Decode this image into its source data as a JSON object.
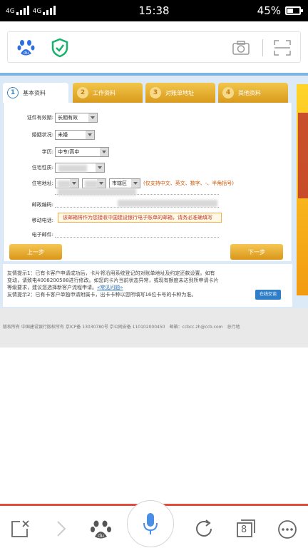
{
  "status_bar": {
    "network": "4G",
    "network2": "4G",
    "time": "15:38",
    "battery": "45%",
    "battery_level": 0.45
  },
  "browser": {
    "logo_icon": "baidu-paw-icon",
    "security_icon": "shield-check-icon",
    "camera_icon": "camera-icon",
    "scan_icon": "scan-icon"
  },
  "form": {
    "tabs": [
      {
        "num": "1",
        "label": "基本资料"
      },
      {
        "num": "2",
        "label": "工作资料"
      },
      {
        "num": "3",
        "label": "对账单地址"
      },
      {
        "num": "4",
        "label": "其他资料"
      }
    ],
    "fields": {
      "id_validity_label": "证件有效期:",
      "id_validity_value": "长期有效",
      "marital_label": "婚姻状况:",
      "marital_value": "未婚",
      "education_label": "学历:",
      "education_value": "中专/高中",
      "residence_type_label": "住宅性质:",
      "address_label": "住宅地址:",
      "address_city": "市辖区",
      "address_hint": "(仅支持中文、英文、数字、-、半角括号)",
      "postcode_label": "邮政编码:",
      "mobile_label": "移动电话:",
      "email_label": "电子邮件:",
      "email_notice": "该邮箱将作为您接收中国建设银行电子账单的邮箱，请务必准确填写"
    },
    "prev_button": "上一步",
    "next_button": "下一步",
    "tips": {
      "tip1_a": "友情提示1：已有卡客户申请成功后，卡片将沿用系统登记的对账单地址及约定还款设置。如有",
      "tip1_b": "变动，请致电4008200588进行修改。如您的卡片当前状态异常，或现有额度未达到所申请卡片",
      "tip1_c": "等级要求，建议您选择新客户流程申请。",
      "tip1_link": "«常见问题»",
      "tip2": "友情提示2：已有卡客户单独申请附属卡，出卡卡种以您所填写16位卡号的卡种为准。",
      "chat_button": "在线交谈"
    }
  },
  "footer": {
    "copyright": "版权所有 中国建设银行版权所有 京ICP备 13030780号  京公网安备 110102000450",
    "email": "邮箱：ccbcc.zh@ccb.com",
    "tail": "总行地"
  },
  "bottom_bar": {
    "tab_count": "8"
  }
}
